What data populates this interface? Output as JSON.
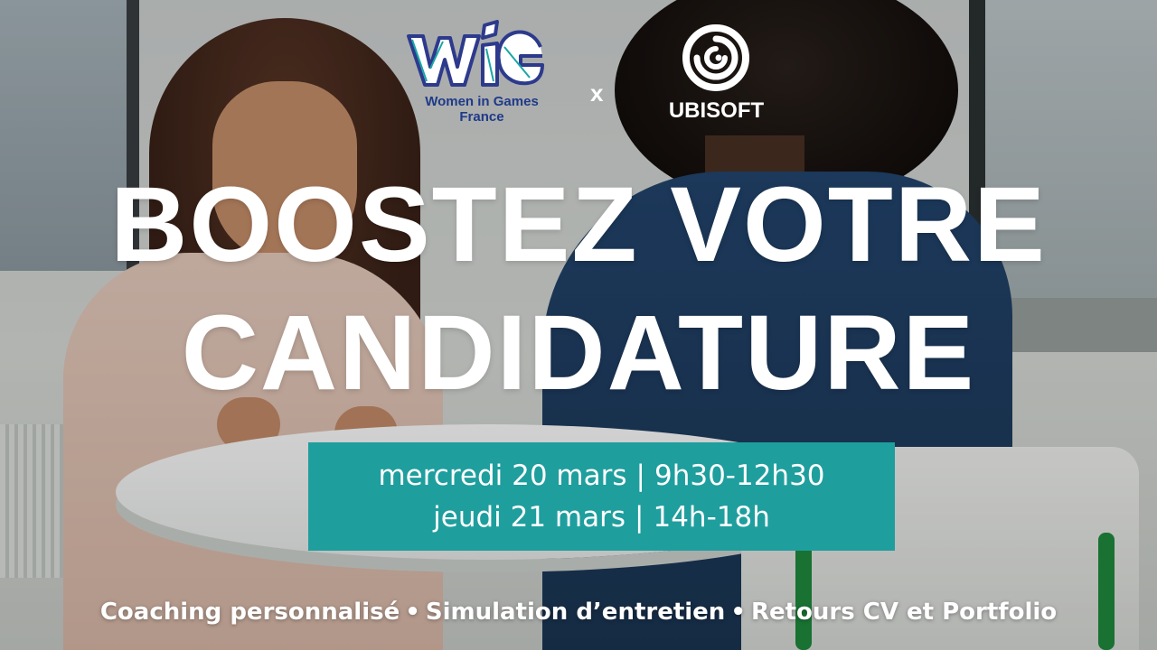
{
  "logos": {
    "wig_mark": "WiG",
    "wig_subtitle": "Women in Games France",
    "wig_color": "#1f3a8a",
    "times": "x",
    "ubisoft": "UBISOFT",
    "ubisoft_icon": "ubisoft-swirl-icon"
  },
  "headline": {
    "line1": "BOOSTEZ VOTRE",
    "line2": "CANDIDATURE"
  },
  "schedule": {
    "accent_color": "#1f9e9e",
    "separator": "|",
    "sessions": [
      {
        "day": "mercredi 20 mars",
        "time": "9h30-12h30"
      },
      {
        "day": "jeudi 21 mars",
        "time": "14h-18h"
      }
    ]
  },
  "footer": {
    "bullet": "•",
    "items": [
      "Coaching personnalisé",
      "Simulation d’entretien",
      "Retours CV et Portfolio"
    ]
  }
}
